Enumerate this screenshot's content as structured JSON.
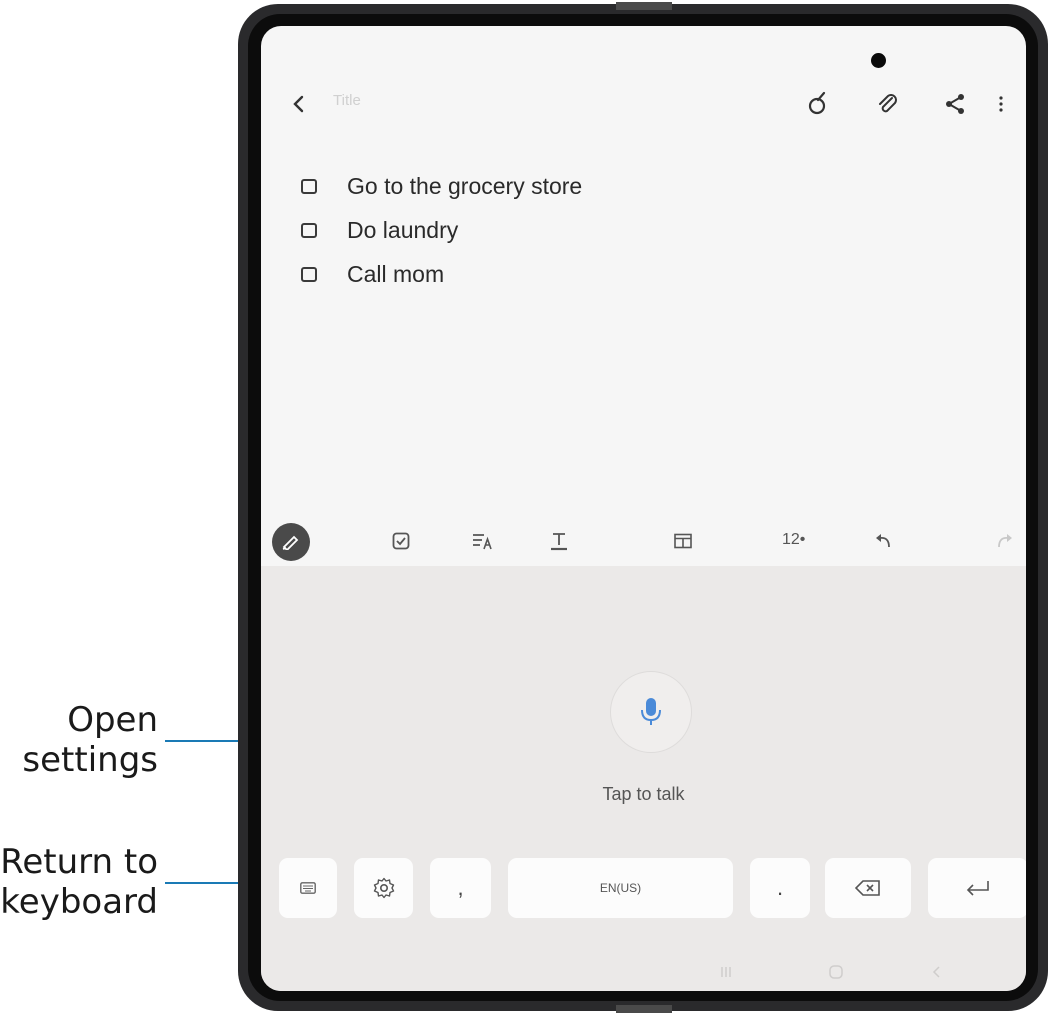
{
  "callouts": {
    "open_settings": [
      "Open",
      "settings"
    ],
    "return_to_keyboard": [
      "Return to",
      "keyboard"
    ]
  },
  "note": {
    "title_placeholder": "Title",
    "items": [
      "Go to the grocery store",
      "Do laundry",
      "Call mom"
    ]
  },
  "toolbar": {
    "font_size": "12•"
  },
  "voice": {
    "tap_to_talk": "Tap to talk"
  },
  "keys": {
    "comma": ",",
    "space": "EN(US)",
    "period": "."
  },
  "colors": {
    "mic": "#4a8ad8",
    "callout_line": "#1a7ab5",
    "pen_button": "#4a4a4a"
  },
  "icons": [
    "back-arrow-icon",
    "brush-icon",
    "paperclip-icon",
    "share-icon",
    "more-vert-icon",
    "pen-icon",
    "checkbox-icon",
    "text-style-icon",
    "text-format-icon",
    "table-icon",
    "undo-icon",
    "redo-icon",
    "mic-icon",
    "keyboard-icon",
    "gear-icon",
    "backspace-icon",
    "enter-icon",
    "recents-icon",
    "home-icon",
    "back-nav-icon"
  ]
}
